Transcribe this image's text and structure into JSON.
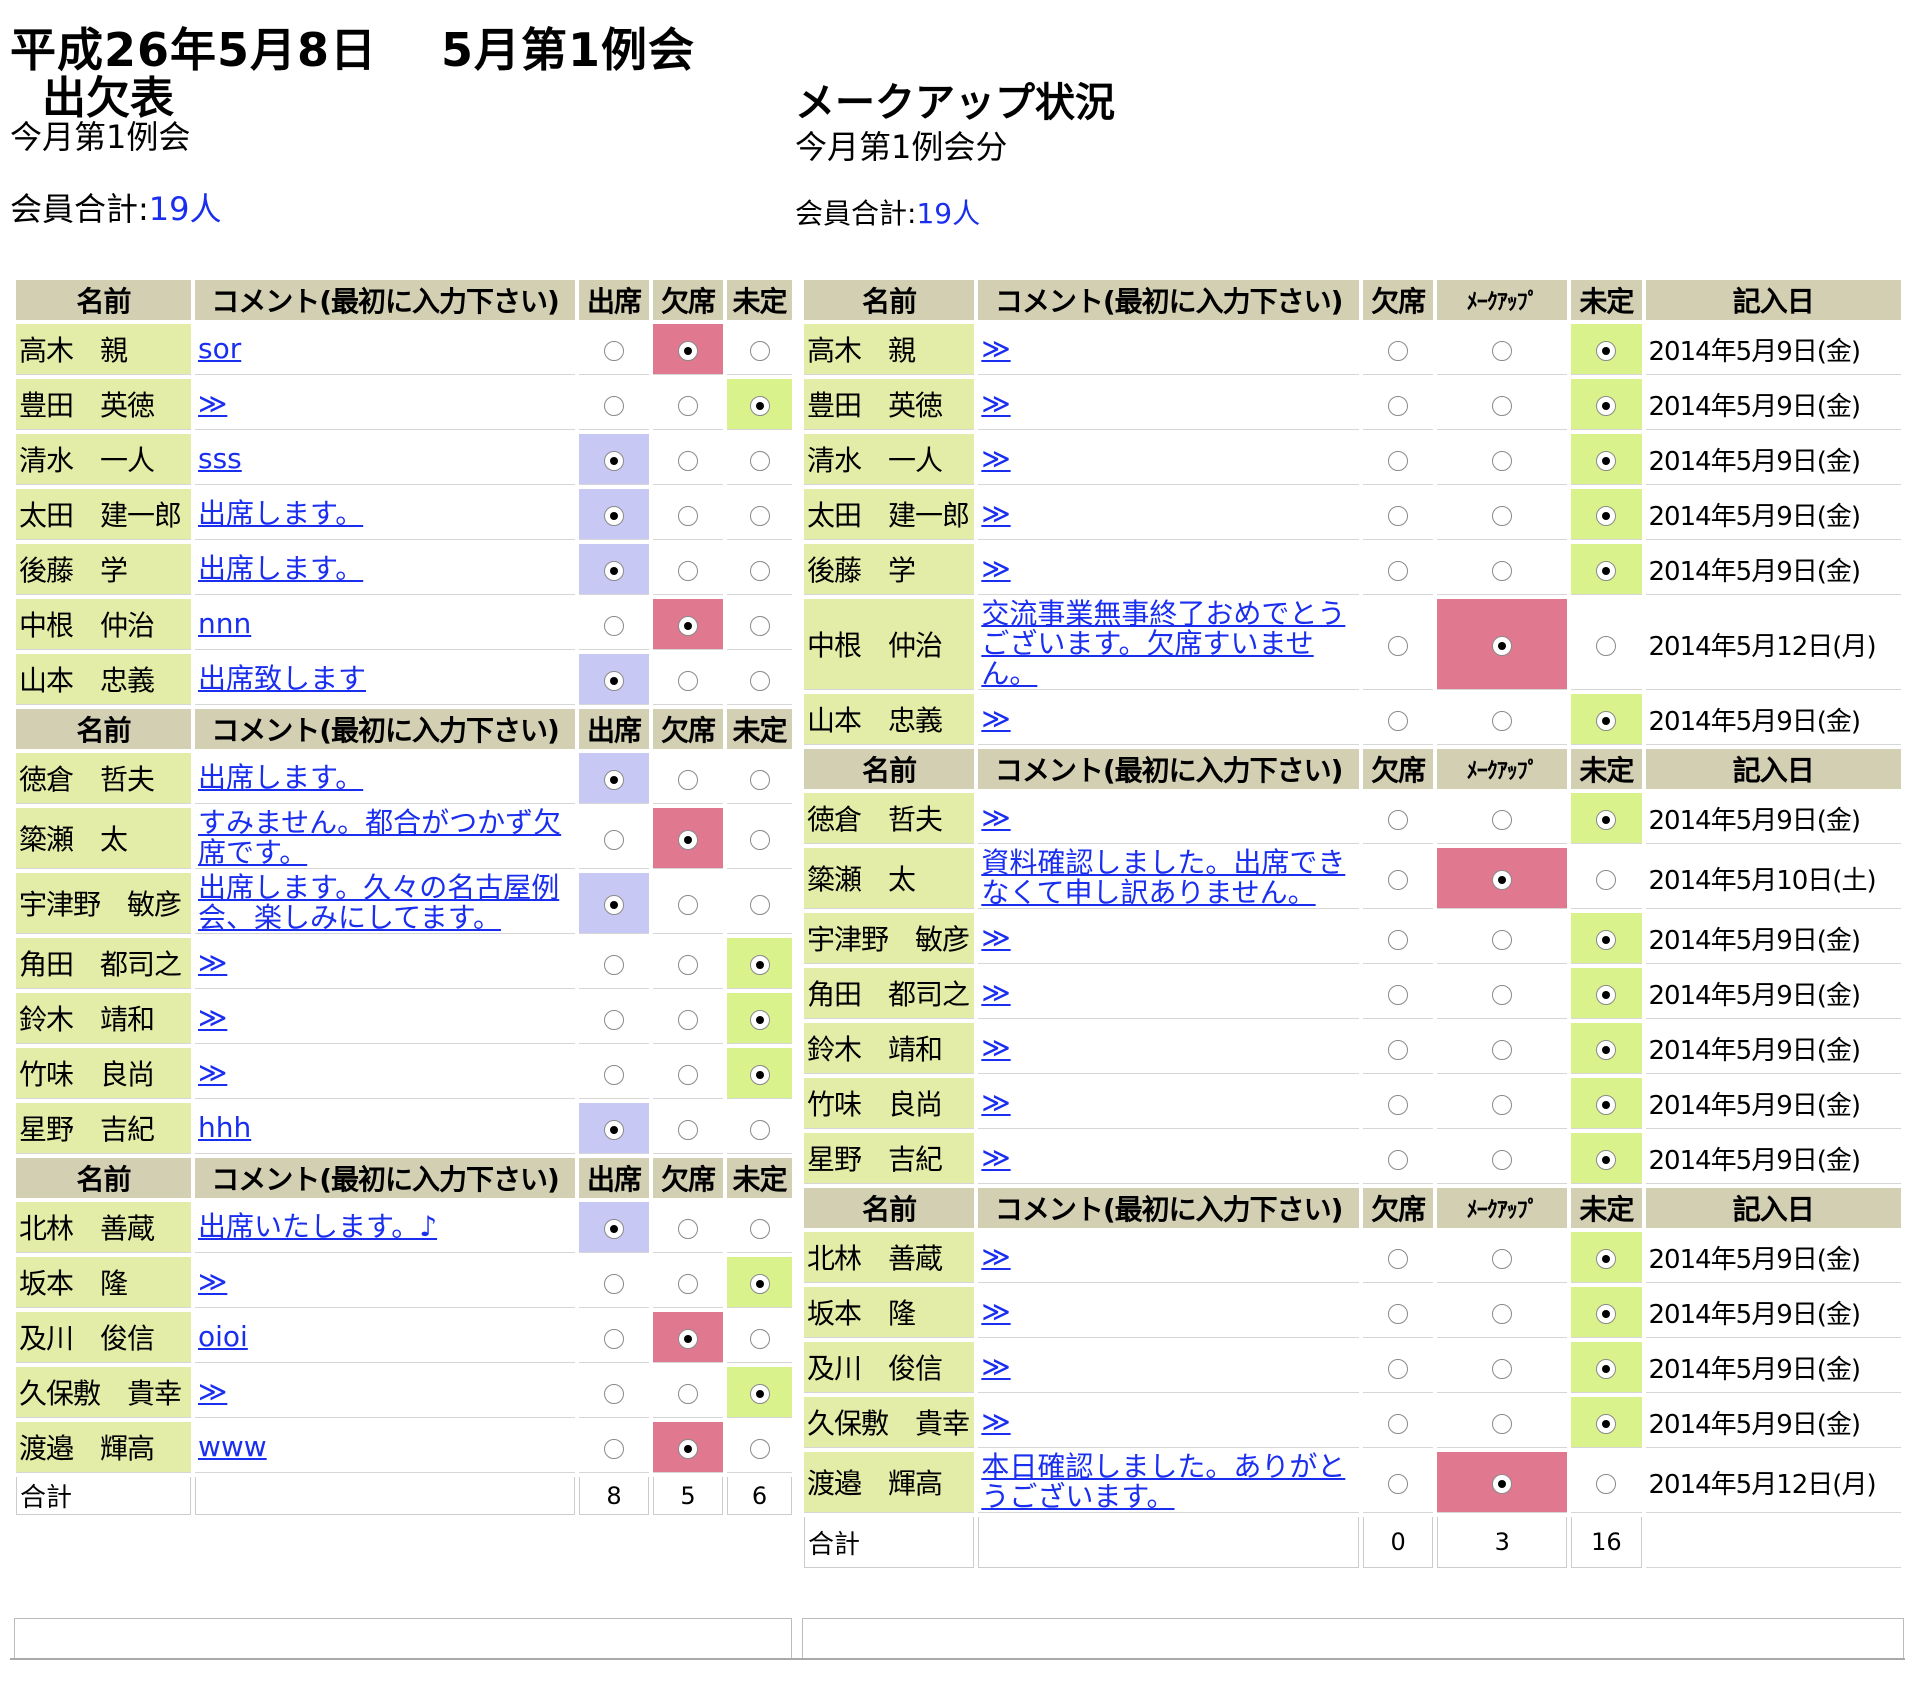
{
  "header": {
    "title": "平成26年5月8日　 5月第1例会",
    "subtitle": "出欠表",
    "left_meeting": "今月第1例会",
    "left_count_label": "会員合計:",
    "left_count_value": "19人",
    "right_title": "メークアップ状況",
    "right_meeting": "今月第1例会分",
    "right_count_label": "会員合計:",
    "right_count_value": "19人"
  },
  "left_table": {
    "headers": {
      "name": "名前",
      "comment": "コメント(最初に入力下さい)",
      "attend": "出席",
      "absent": "欠席",
      "undecided": "未定"
    },
    "total_label": "合計",
    "totals": [
      "8",
      "5",
      "6"
    ]
  },
  "right_table": {
    "headers": {
      "name": "名前",
      "comment": "コメント(最初に入力下さい)",
      "absent": "欠席",
      "makeup": "ﾒｰｸｱｯﾌﾟ",
      "undecided": "未定",
      "date": "記入日"
    },
    "total_label": "合計",
    "totals": [
      "0",
      "3",
      "16"
    ]
  },
  "groups": [
    [
      {
        "name": "高木　親",
        "comment": "sor",
        "status": "absent",
        "mk_comment": "≫",
        "mk_status": "undecided",
        "date": "2014年5月9日(金)"
      },
      {
        "name": "豊田　英徳",
        "comment": "≫",
        "status": "undecided",
        "mk_comment": "≫",
        "mk_status": "undecided",
        "date": "2014年5月9日(金)"
      },
      {
        "name": "清水　一人",
        "comment": "sss",
        "status": "attend",
        "mk_comment": "≫",
        "mk_status": "undecided",
        "date": "2014年5月9日(金)"
      },
      {
        "name": "太田　建一郎",
        "comment": "出席します。",
        "status": "attend",
        "mk_comment": "≫",
        "mk_status": "undecided",
        "date": "2014年5月9日(金)"
      },
      {
        "name": "後藤　学",
        "comment": "出席します。",
        "status": "attend",
        "mk_comment": "≫",
        "mk_status": "undecided",
        "date": "2014年5月9日(金)"
      },
      {
        "name": "中根　仲治",
        "comment": "nnn",
        "status": "absent",
        "mk_comment": "交流事業無事終了おめでとうございます。欠席すいません。",
        "mk_status": "makeup",
        "date": "2014年5月12日(月)"
      },
      {
        "name": "山本　忠義",
        "comment": "出席致します",
        "status": "attend",
        "mk_comment": "≫",
        "mk_status": "undecided",
        "date": "2014年5月9日(金)"
      }
    ],
    [
      {
        "name": "徳倉　哲夫",
        "comment": "出席します。",
        "status": "attend",
        "mk_comment": "≫",
        "mk_status": "undecided",
        "date": "2014年5月9日(金)"
      },
      {
        "name": "簗瀬　太",
        "comment": "すみません。都合がつかず欠席です。",
        "status": "absent",
        "mk_comment": "資料確認しました。出席できなくて申し訳ありません。",
        "mk_status": "makeup",
        "date": "2014年5月10日(土)"
      },
      {
        "name": "宇津野　敏彦",
        "comment": "出席します。久々の名古屋例会、楽しみにしてます。",
        "status": "attend",
        "mk_comment": "≫",
        "mk_status": "undecided",
        "date": "2014年5月9日(金)"
      },
      {
        "name": "角田　都司之",
        "comment": "≫",
        "status": "undecided",
        "mk_comment": "≫",
        "mk_status": "undecided",
        "date": "2014年5月9日(金)"
      },
      {
        "name": "鈴木　靖和",
        "comment": "≫",
        "status": "undecided",
        "mk_comment": "≫",
        "mk_status": "undecided",
        "date": "2014年5月9日(金)"
      },
      {
        "name": "竹味　良尚",
        "comment": "≫",
        "status": "undecided",
        "mk_comment": "≫",
        "mk_status": "undecided",
        "date": "2014年5月9日(金)"
      },
      {
        "name": "星野　吉紀",
        "comment": "hhh",
        "status": "attend",
        "mk_comment": "≫",
        "mk_status": "undecided",
        "date": "2014年5月9日(金)"
      }
    ],
    [
      {
        "name": "北林　善蔵",
        "comment": "出席いたします。♪",
        "status": "attend",
        "mk_comment": "≫",
        "mk_status": "undecided",
        "date": "2014年5月9日(金)"
      },
      {
        "name": "坂本　隆",
        "comment": "≫",
        "status": "undecided",
        "mk_comment": "≫",
        "mk_status": "undecided",
        "date": "2014年5月9日(金)"
      },
      {
        "name": "及川　俊信",
        "comment": "oioi",
        "status": "absent",
        "mk_comment": "≫",
        "mk_status": "undecided",
        "date": "2014年5月9日(金)"
      },
      {
        "name": "久保敷　貴幸",
        "comment": "≫",
        "status": "undecided",
        "mk_comment": "≫",
        "mk_status": "undecided",
        "date": "2014年5月9日(金)"
      },
      {
        "name": "渡邉　輝高",
        "comment": "www",
        "status": "absent",
        "mk_comment": "本日確認しました。ありがとうございます。",
        "mk_status": "makeup",
        "date": "2014年5月12日(月)"
      }
    ]
  ],
  "colors": {
    "attend": "#c8c8f4",
    "absent_makeup": "#e07890",
    "undecided": "#d9f28c",
    "name_cell": "#e3eda7",
    "header": "#d3cfb3",
    "link": "#1a2ef0"
  }
}
